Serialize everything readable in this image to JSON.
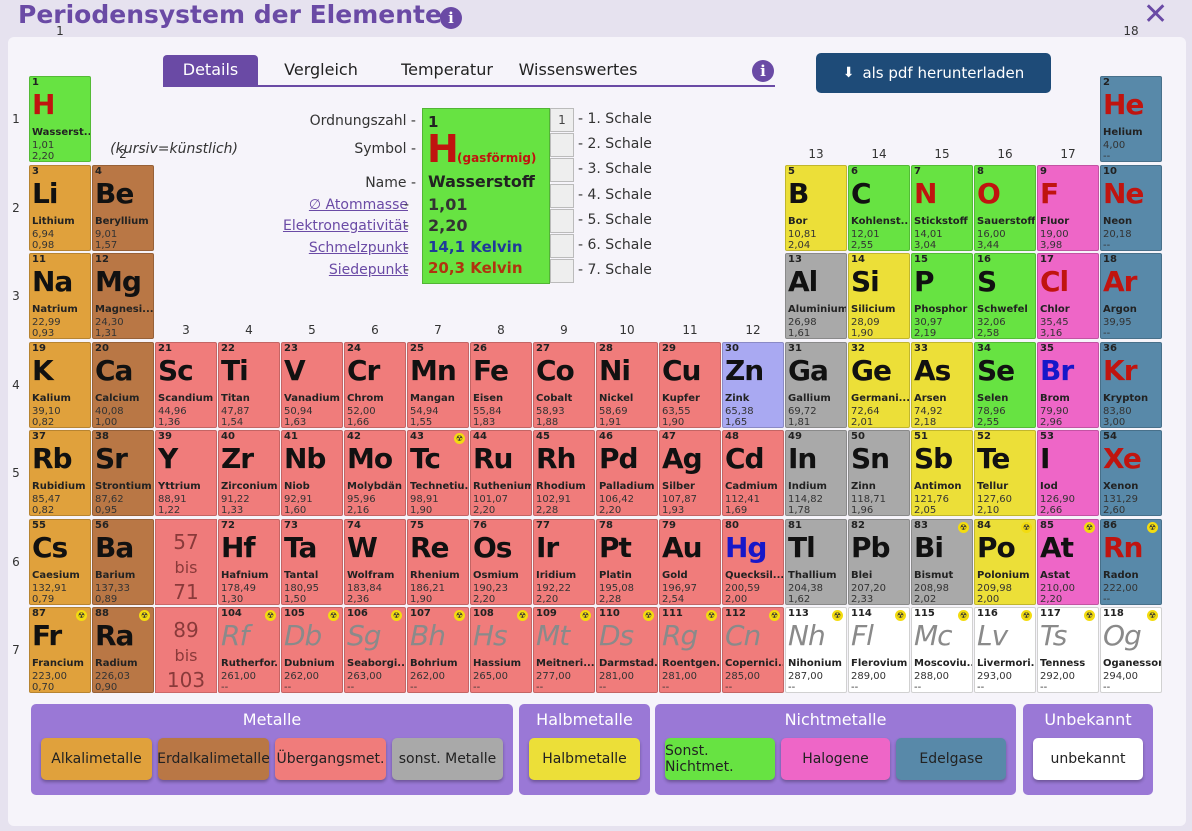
{
  "title": "Periodensystem der Elemente",
  "title_info": "i",
  "close_label": "✕",
  "tabs": [
    {
      "label": "Details",
      "active": true
    },
    {
      "label": "Vergleich",
      "active": false
    },
    {
      "label": "Temperatur",
      "active": false
    },
    {
      "label": "Wissenswertes",
      "active": false
    }
  ],
  "tab_info": "i",
  "pdf_button": {
    "icon": "download-icon",
    "label": "als pdf herunterladen"
  },
  "group_labels": [
    "1",
    "2",
    "3",
    "4",
    "5",
    "6",
    "7",
    "8",
    "9",
    "10",
    "11",
    "12",
    "13",
    "14",
    "15",
    "16",
    "17",
    "18"
  ],
  "period_labels": [
    "1",
    "2",
    "3",
    "4",
    "5",
    "6",
    "7"
  ],
  "placeholders": [
    {
      "top": "57",
      "mid": "bis",
      "bot": "71"
    },
    {
      "top": "89",
      "mid": "bis",
      "bot": "103"
    }
  ],
  "details": {
    "labels": {
      "number": "Ordnungszahl -",
      "symbol": "Symbol -",
      "symbol_note": "(kursiv=künstlich)",
      "name": "Name -",
      "mass": "∅ Atommasse",
      "en": "Elektronegativität",
      "mp": "Schmelzpunkt",
      "bp": "Siedepunkt",
      "dash": "-"
    },
    "number": "1",
    "symbol": "H",
    "state": "(gasförmig)",
    "name": "Wasserstoff",
    "mass": "1,01",
    "en": "2,20",
    "melting": "14,1 Kelvin",
    "boiling": "20,3 Kelvin",
    "shells": [
      {
        "value": "1",
        "label": "- 1. Schale"
      },
      {
        "value": "",
        "label": "- 2. Schale"
      },
      {
        "value": "",
        "label": "- 3. Schale"
      },
      {
        "value": "",
        "label": "- 4. Schale"
      },
      {
        "value": "",
        "label": "- 5. Schale"
      },
      {
        "value": "",
        "label": "- 6. Schale"
      },
      {
        "value": "",
        "label": "- 7. Schale"
      }
    ]
  },
  "colors": {
    "alkali": "#e0a13c",
    "erdalkali": "#b97745",
    "transition": "#f07c7b",
    "metal": "#a9a9a9",
    "halbmetall": "#ecdf38",
    "nichtmetall": "#67e342",
    "halogen": "#ee66c7",
    "edelgas": "#5889a9",
    "unknown": "#ffffff",
    "hydrogen_selected": "#67e342",
    "accent": "#6a4aa5"
  },
  "legend": [
    {
      "header": "Metalle",
      "buttons": [
        {
          "label": "Alkalimetalle",
          "color": "#e0a13c"
        },
        {
          "label": "Erdalkalimetalle",
          "color": "#b97745"
        },
        {
          "label": "Übergangsmet.",
          "color": "#f07c7b"
        },
        {
          "label": "sonst. Metalle",
          "color": "#a9a9a9"
        }
      ]
    },
    {
      "header": "Halbmetalle",
      "buttons": [
        {
          "label": "Halbmetalle",
          "color": "#ecdf38"
        }
      ]
    },
    {
      "header": "Nichtmetalle",
      "buttons": [
        {
          "label": "Sonst. Nichtmet.",
          "color": "#67e342"
        },
        {
          "label": "Halogene",
          "color": "#ee66c7"
        },
        {
          "label": "Edelgase",
          "color": "#5889a9"
        }
      ]
    },
    {
      "header": "Unbekannt",
      "buttons": [
        {
          "label": "unbekannt",
          "color": "#ffffff"
        }
      ]
    }
  ],
  "elements": [
    {
      "n": "1",
      "s": "H",
      "name": "Wasserst...",
      "m": "1,01",
      "e": "2,20",
      "g": 1,
      "p": 1,
      "c": "nichtmetall",
      "sc": "red"
    },
    {
      "n": "2",
      "s": "He",
      "name": "Helium",
      "m": "4,00",
      "e": "--",
      "g": 18,
      "p": 1,
      "c": "edelgas",
      "sc": "red"
    },
    {
      "n": "3",
      "s": "Li",
      "name": "Lithium",
      "m": "6,94",
      "e": "0,98",
      "g": 1,
      "p": 2,
      "c": "alkali",
      "sc": ""
    },
    {
      "n": "4",
      "s": "Be",
      "name": "Beryllium",
      "m": "9,01",
      "e": "1,57",
      "g": 2,
      "p": 2,
      "c": "erdalkali",
      "sc": ""
    },
    {
      "n": "5",
      "s": "B",
      "name": "Bor",
      "m": "10,81",
      "e": "2,04",
      "g": 13,
      "p": 2,
      "c": "halbmetall",
      "sc": ""
    },
    {
      "n": "6",
      "s": "C",
      "name": "Kohlenst...",
      "m": "12,01",
      "e": "2,55",
      "g": 14,
      "p": 2,
      "c": "nichtmetall",
      "sc": ""
    },
    {
      "n": "7",
      "s": "N",
      "name": "Stickstoff",
      "m": "14,01",
      "e": "3,04",
      "g": 15,
      "p": 2,
      "c": "nichtmetall",
      "sc": "red"
    },
    {
      "n": "8",
      "s": "O",
      "name": "Sauerstoff",
      "m": "16,00",
      "e": "3,44",
      "g": 16,
      "p": 2,
      "c": "nichtmetall",
      "sc": "red"
    },
    {
      "n": "9",
      "s": "F",
      "name": "Fluor",
      "m": "19,00",
      "e": "3,98",
      "g": 17,
      "p": 2,
      "c": "halogen",
      "sc": "red"
    },
    {
      "n": "10",
      "s": "Ne",
      "name": "Neon",
      "m": "20,18",
      "e": "--",
      "g": 18,
      "p": 2,
      "c": "edelgas",
      "sc": "red"
    },
    {
      "n": "11",
      "s": "Na",
      "name": "Natrium",
      "m": "22,99",
      "e": "0,93",
      "g": 1,
      "p": 3,
      "c": "alkali",
      "sc": ""
    },
    {
      "n": "12",
      "s": "Mg",
      "name": "Magnesi...",
      "m": "24,30",
      "e": "1,31",
      "g": 2,
      "p": 3,
      "c": "erdalkali",
      "sc": ""
    },
    {
      "n": "13",
      "s": "Al",
      "name": "Aluminium",
      "m": "26,98",
      "e": "1,61",
      "g": 13,
      "p": 3,
      "c": "metal",
      "sc": ""
    },
    {
      "n": "14",
      "s": "Si",
      "name": "Silicium",
      "m": "28,09",
      "e": "1,90",
      "g": 14,
      "p": 3,
      "c": "halbmetall",
      "sc": ""
    },
    {
      "n": "15",
      "s": "P",
      "name": "Phosphor",
      "m": "30,97",
      "e": "2,19",
      "g": 15,
      "p": 3,
      "c": "nichtmetall",
      "sc": ""
    },
    {
      "n": "16",
      "s": "S",
      "name": "Schwefel",
      "m": "32,06",
      "e": "2,58",
      "g": 16,
      "p": 3,
      "c": "nichtmetall",
      "sc": ""
    },
    {
      "n": "17",
      "s": "Cl",
      "name": "Chlor",
      "m": "35,45",
      "e": "3,16",
      "g": 17,
      "p": 3,
      "c": "halogen",
      "sc": "red"
    },
    {
      "n": "18",
      "s": "Ar",
      "name": "Argon",
      "m": "39,95",
      "e": "--",
      "g": 18,
      "p": 3,
      "c": "edelgas",
      "sc": "red"
    },
    {
      "n": "19",
      "s": "K",
      "name": "Kalium",
      "m": "39,10",
      "e": "0,82",
      "g": 1,
      "p": 4,
      "c": "alkali",
      "sc": ""
    },
    {
      "n": "20",
      "s": "Ca",
      "name": "Calcium",
      "m": "40,08",
      "e": "1,00",
      "g": 2,
      "p": 4,
      "c": "erdalkali",
      "sc": ""
    },
    {
      "n": "21",
      "s": "Sc",
      "name": "Scandium",
      "m": "44,96",
      "e": "1,36",
      "g": 3,
      "p": 4,
      "c": "transition",
      "sc": ""
    },
    {
      "n": "22",
      "s": "Ti",
      "name": "Titan",
      "m": "47,87",
      "e": "1,54",
      "g": 4,
      "p": 4,
      "c": "transition",
      "sc": ""
    },
    {
      "n": "23",
      "s": "V",
      "name": "Vanadium",
      "m": "50,94",
      "e": "1,63",
      "g": 5,
      "p": 4,
      "c": "transition",
      "sc": ""
    },
    {
      "n": "24",
      "s": "Cr",
      "name": "Chrom",
      "m": "52,00",
      "e": "1,66",
      "g": 6,
      "p": 4,
      "c": "transition",
      "sc": ""
    },
    {
      "n": "25",
      "s": "Mn",
      "name": "Mangan",
      "m": "54,94",
      "e": "1,55",
      "g": 7,
      "p": 4,
      "c": "transition",
      "sc": ""
    },
    {
      "n": "26",
      "s": "Fe",
      "name": "Eisen",
      "m": "55,84",
      "e": "1,83",
      "g": 8,
      "p": 4,
      "c": "transition",
      "sc": ""
    },
    {
      "n": "27",
      "s": "Co",
      "name": "Cobalt",
      "m": "58,93",
      "e": "1,88",
      "g": 9,
      "p": 4,
      "c": "transition",
      "sc": ""
    },
    {
      "n": "28",
      "s": "Ni",
      "name": "Nickel",
      "m": "58,69",
      "e": "1,91",
      "g": 10,
      "p": 4,
      "c": "transition",
      "sc": ""
    },
    {
      "n": "29",
      "s": "Cu",
      "name": "Kupfer",
      "m": "63,55",
      "e": "1,90",
      "g": 11,
      "p": 4,
      "c": "transition",
      "sc": ""
    },
    {
      "n": "30",
      "s": "Zn",
      "name": "Zink",
      "m": "65,38",
      "e": "1,65",
      "g": 12,
      "p": 4,
      "c": "zink",
      "sc": ""
    },
    {
      "n": "31",
      "s": "Ga",
      "name": "Gallium",
      "m": "69,72",
      "e": "1,81",
      "g": 13,
      "p": 4,
      "c": "metal",
      "sc": ""
    },
    {
      "n": "32",
      "s": "Ge",
      "name": "Germani...",
      "m": "72,64",
      "e": "2,01",
      "g": 14,
      "p": 4,
      "c": "halbmetall",
      "sc": ""
    },
    {
      "n": "33",
      "s": "As",
      "name": "Arsen",
      "m": "74,92",
      "e": "2,18",
      "g": 15,
      "p": 4,
      "c": "halbmetall",
      "sc": ""
    },
    {
      "n": "34",
      "s": "Se",
      "name": "Selen",
      "m": "78,96",
      "e": "2,55",
      "g": 16,
      "p": 4,
      "c": "nichtmetall",
      "sc": ""
    },
    {
      "n": "35",
      "s": "Br",
      "name": "Brom",
      "m": "79,90",
      "e": "2,96",
      "g": 17,
      "p": 4,
      "c": "halogen",
      "sc": "blue"
    },
    {
      "n": "36",
      "s": "Kr",
      "name": "Krypton",
      "m": "83,80",
      "e": "3,00",
      "g": 18,
      "p": 4,
      "c": "edelgas",
      "sc": "red"
    },
    {
      "n": "37",
      "s": "Rb",
      "name": "Rubidium",
      "m": "85,47",
      "e": "0,82",
      "g": 1,
      "p": 5,
      "c": "alkali",
      "sc": ""
    },
    {
      "n": "38",
      "s": "Sr",
      "name": "Strontium",
      "m": "87,62",
      "e": "0,95",
      "g": 2,
      "p": 5,
      "c": "erdalkali",
      "sc": ""
    },
    {
      "n": "39",
      "s": "Y",
      "name": "Yttrium",
      "m": "88,91",
      "e": "1,22",
      "g": 3,
      "p": 5,
      "c": "transition",
      "sc": ""
    },
    {
      "n": "40",
      "s": "Zr",
      "name": "Zirconium",
      "m": "91,22",
      "e": "1,33",
      "g": 4,
      "p": 5,
      "c": "transition",
      "sc": ""
    },
    {
      "n": "41",
      "s": "Nb",
      "name": "Niob",
      "m": "92,91",
      "e": "1,60",
      "g": 5,
      "p": 5,
      "c": "transition",
      "sc": ""
    },
    {
      "n": "42",
      "s": "Mo",
      "name": "Molybdän",
      "m": "95,96",
      "e": "2,16",
      "g": 6,
      "p": 5,
      "c": "transition",
      "sc": ""
    },
    {
      "n": "43",
      "s": "Tc",
      "name": "Technetiu...",
      "m": "98,91",
      "e": "1,90",
      "g": 7,
      "p": 5,
      "c": "transition",
      "sc": "",
      "r": true
    },
    {
      "n": "44",
      "s": "Ru",
      "name": "Ruthenium",
      "m": "101,07",
      "e": "2,20",
      "g": 8,
      "p": 5,
      "c": "transition",
      "sc": ""
    },
    {
      "n": "45",
      "s": "Rh",
      "name": "Rhodium",
      "m": "102,91",
      "e": "2,28",
      "g": 9,
      "p": 5,
      "c": "transition",
      "sc": ""
    },
    {
      "n": "46",
      "s": "Pd",
      "name": "Palladium",
      "m": "106,42",
      "e": "2,20",
      "g": 10,
      "p": 5,
      "c": "transition",
      "sc": ""
    },
    {
      "n": "47",
      "s": "Ag",
      "name": "Silber",
      "m": "107,87",
      "e": "1,93",
      "g": 11,
      "p": 5,
      "c": "transition",
      "sc": ""
    },
    {
      "n": "48",
      "s": "Cd",
      "name": "Cadmium",
      "m": "112,41",
      "e": "1,69",
      "g": 12,
      "p": 5,
      "c": "transition",
      "sc": ""
    },
    {
      "n": "49",
      "s": "In",
      "name": "Indium",
      "m": "114,82",
      "e": "1,78",
      "g": 13,
      "p": 5,
      "c": "metal",
      "sc": ""
    },
    {
      "n": "50",
      "s": "Sn",
      "name": "Zinn",
      "m": "118,71",
      "e": "1,96",
      "g": 14,
      "p": 5,
      "c": "metal",
      "sc": ""
    },
    {
      "n": "51",
      "s": "Sb",
      "name": "Antimon",
      "m": "121,76",
      "e": "2,05",
      "g": 15,
      "p": 5,
      "c": "halbmetall",
      "sc": ""
    },
    {
      "n": "52",
      "s": "Te",
      "name": "Tellur",
      "m": "127,60",
      "e": "2,10",
      "g": 16,
      "p": 5,
      "c": "halbmetall",
      "sc": ""
    },
    {
      "n": "53",
      "s": "I",
      "name": "Iod",
      "m": "126,90",
      "e": "2,66",
      "g": 17,
      "p": 5,
      "c": "halogen",
      "sc": ""
    },
    {
      "n": "54",
      "s": "Xe",
      "name": "Xenon",
      "m": "131,29",
      "e": "2,60",
      "g": 18,
      "p": 5,
      "c": "edelgas",
      "sc": "red"
    },
    {
      "n": "55",
      "s": "Cs",
      "name": "Caesium",
      "m": "132,91",
      "e": "0,79",
      "g": 1,
      "p": 6,
      "c": "alkali",
      "sc": ""
    },
    {
      "n": "56",
      "s": "Ba",
      "name": "Barium",
      "m": "137,33",
      "e": "0,89",
      "g": 2,
      "p": 6,
      "c": "erdalkali",
      "sc": ""
    },
    {
      "n": "72",
      "s": "Hf",
      "name": "Hafnium",
      "m": "178,49",
      "e": "1,30",
      "g": 4,
      "p": 6,
      "c": "transition",
      "sc": ""
    },
    {
      "n": "73",
      "s": "Ta",
      "name": "Tantal",
      "m": "180,95",
      "e": "1,50",
      "g": 5,
      "p": 6,
      "c": "transition",
      "sc": ""
    },
    {
      "n": "74",
      "s": "W",
      "name": "Wolfram",
      "m": "183,84",
      "e": "2,36",
      "g": 6,
      "p": 6,
      "c": "transition",
      "sc": ""
    },
    {
      "n": "75",
      "s": "Re",
      "name": "Rhenium",
      "m": "186,21",
      "e": "1,90",
      "g": 7,
      "p": 6,
      "c": "transition",
      "sc": ""
    },
    {
      "n": "76",
      "s": "Os",
      "name": "Osmium",
      "m": "190,23",
      "e": "2,20",
      "g": 8,
      "p": 6,
      "c": "transition",
      "sc": ""
    },
    {
      "n": "77",
      "s": "Ir",
      "name": "Iridium",
      "m": "192,22",
      "e": "2,20",
      "g": 9,
      "p": 6,
      "c": "transition",
      "sc": ""
    },
    {
      "n": "78",
      "s": "Pt",
      "name": "Platin",
      "m": "195,08",
      "e": "2,28",
      "g": 10,
      "p": 6,
      "c": "transition",
      "sc": ""
    },
    {
      "n": "79",
      "s": "Au",
      "name": "Gold",
      "m": "196,97",
      "e": "2,54",
      "g": 11,
      "p": 6,
      "c": "transition",
      "sc": ""
    },
    {
      "n": "80",
      "s": "Hg",
      "name": "Quecksil...",
      "m": "200,59",
      "e": "2,00",
      "g": 12,
      "p": 6,
      "c": "transition",
      "sc": "blue"
    },
    {
      "n": "81",
      "s": "Tl",
      "name": "Thallium",
      "m": "204,38",
      "e": "1,62",
      "g": 13,
      "p": 6,
      "c": "metal",
      "sc": ""
    },
    {
      "n": "82",
      "s": "Pb",
      "name": "Blei",
      "m": "207,20",
      "e": "2,33",
      "g": 14,
      "p": 6,
      "c": "metal",
      "sc": ""
    },
    {
      "n": "83",
      "s": "Bi",
      "name": "Bismut",
      "m": "208,98",
      "e": "2,02",
      "g": 15,
      "p": 6,
      "c": "metal",
      "sc": "",
      "r": true
    },
    {
      "n": "84",
      "s": "Po",
      "name": "Polonium",
      "m": "209,98",
      "e": "2,00",
      "g": 16,
      "p": 6,
      "c": "halbmetall",
      "sc": "",
      "r": true
    },
    {
      "n": "85",
      "s": "At",
      "name": "Astat",
      "m": "210,00",
      "e": "2,20",
      "g": 17,
      "p": 6,
      "c": "halogen",
      "sc": "",
      "r": true
    },
    {
      "n": "86",
      "s": "Rn",
      "name": "Radon",
      "m": "222,00",
      "e": "--",
      "g": 18,
      "p": 6,
      "c": "edelgas",
      "sc": "red",
      "r": true
    },
    {
      "n": "87",
      "s": "Fr",
      "name": "Francium",
      "m": "223,00",
      "e": "0,70",
      "g": 1,
      "p": 7,
      "c": "alkali",
      "sc": "",
      "r": true
    },
    {
      "n": "88",
      "s": "Ra",
      "name": "Radium",
      "m": "226,03",
      "e": "0,90",
      "g": 2,
      "p": 7,
      "c": "erdalkali",
      "sc": "",
      "r": true
    },
    {
      "n": "104",
      "s": "Rf",
      "name": "Rutherfor...",
      "m": "261,00",
      "e": "--",
      "g": 4,
      "p": 7,
      "c": "transition",
      "sc": "gray",
      "r": true
    },
    {
      "n": "105",
      "s": "Db",
      "name": "Dubnium",
      "m": "262,00",
      "e": "--",
      "g": 5,
      "p": 7,
      "c": "transition",
      "sc": "gray",
      "r": true
    },
    {
      "n": "106",
      "s": "Sg",
      "name": "Seaborgi...",
      "m": "263,00",
      "e": "--",
      "g": 6,
      "p": 7,
      "c": "transition",
      "sc": "gray",
      "r": true
    },
    {
      "n": "107",
      "s": "Bh",
      "name": "Bohrium",
      "m": "262,00",
      "e": "--",
      "g": 7,
      "p": 7,
      "c": "transition",
      "sc": "gray",
      "r": true
    },
    {
      "n": "108",
      "s": "Hs",
      "name": "Hassium",
      "m": "265,00",
      "e": "--",
      "g": 8,
      "p": 7,
      "c": "transition",
      "sc": "gray",
      "r": true
    },
    {
      "n": "109",
      "s": "Mt",
      "name": "Meitneri...",
      "m": "277,00",
      "e": "--",
      "g": 9,
      "p": 7,
      "c": "transition",
      "sc": "gray",
      "r": true
    },
    {
      "n": "110",
      "s": "Ds",
      "name": "Darmstad...",
      "m": "281,00",
      "e": "--",
      "g": 10,
      "p": 7,
      "c": "transition",
      "sc": "gray",
      "r": true
    },
    {
      "n": "111",
      "s": "Rg",
      "name": "Roentgen...",
      "m": "281,00",
      "e": "--",
      "g": 11,
      "p": 7,
      "c": "transition",
      "sc": "gray",
      "r": true
    },
    {
      "n": "112",
      "s": "Cn",
      "name": "Copernici...",
      "m": "285,00",
      "e": "--",
      "g": 12,
      "p": 7,
      "c": "transition",
      "sc": "gray",
      "r": true
    },
    {
      "n": "113",
      "s": "Nh",
      "name": "Nihonium",
      "m": "287,00",
      "e": "--",
      "g": 13,
      "p": 7,
      "c": "unknown",
      "sc": "gray",
      "r": true
    },
    {
      "n": "114",
      "s": "Fl",
      "name": "Flerovium",
      "m": "289,00",
      "e": "--",
      "g": 14,
      "p": 7,
      "c": "unknown",
      "sc": "gray",
      "r": true
    },
    {
      "n": "115",
      "s": "Mc",
      "name": "Moscoviu...",
      "m": "288,00",
      "e": "--",
      "g": 15,
      "p": 7,
      "c": "unknown",
      "sc": "gray",
      "r": true
    },
    {
      "n": "116",
      "s": "Lv",
      "name": "Livermori...",
      "m": "293,00",
      "e": "--",
      "g": 16,
      "p": 7,
      "c": "unknown",
      "sc": "gray",
      "r": true
    },
    {
      "n": "117",
      "s": "Ts",
      "name": "Tenness",
      "m": "292,00",
      "e": "--",
      "g": 17,
      "p": 7,
      "c": "unknown",
      "sc": "gray",
      "r": true
    },
    {
      "n": "118",
      "s": "Og",
      "name": "Oganesson",
      "m": "294,00",
      "e": "--",
      "g": 18,
      "p": 7,
      "c": "unknown",
      "sc": "gray",
      "r": true
    }
  ]
}
